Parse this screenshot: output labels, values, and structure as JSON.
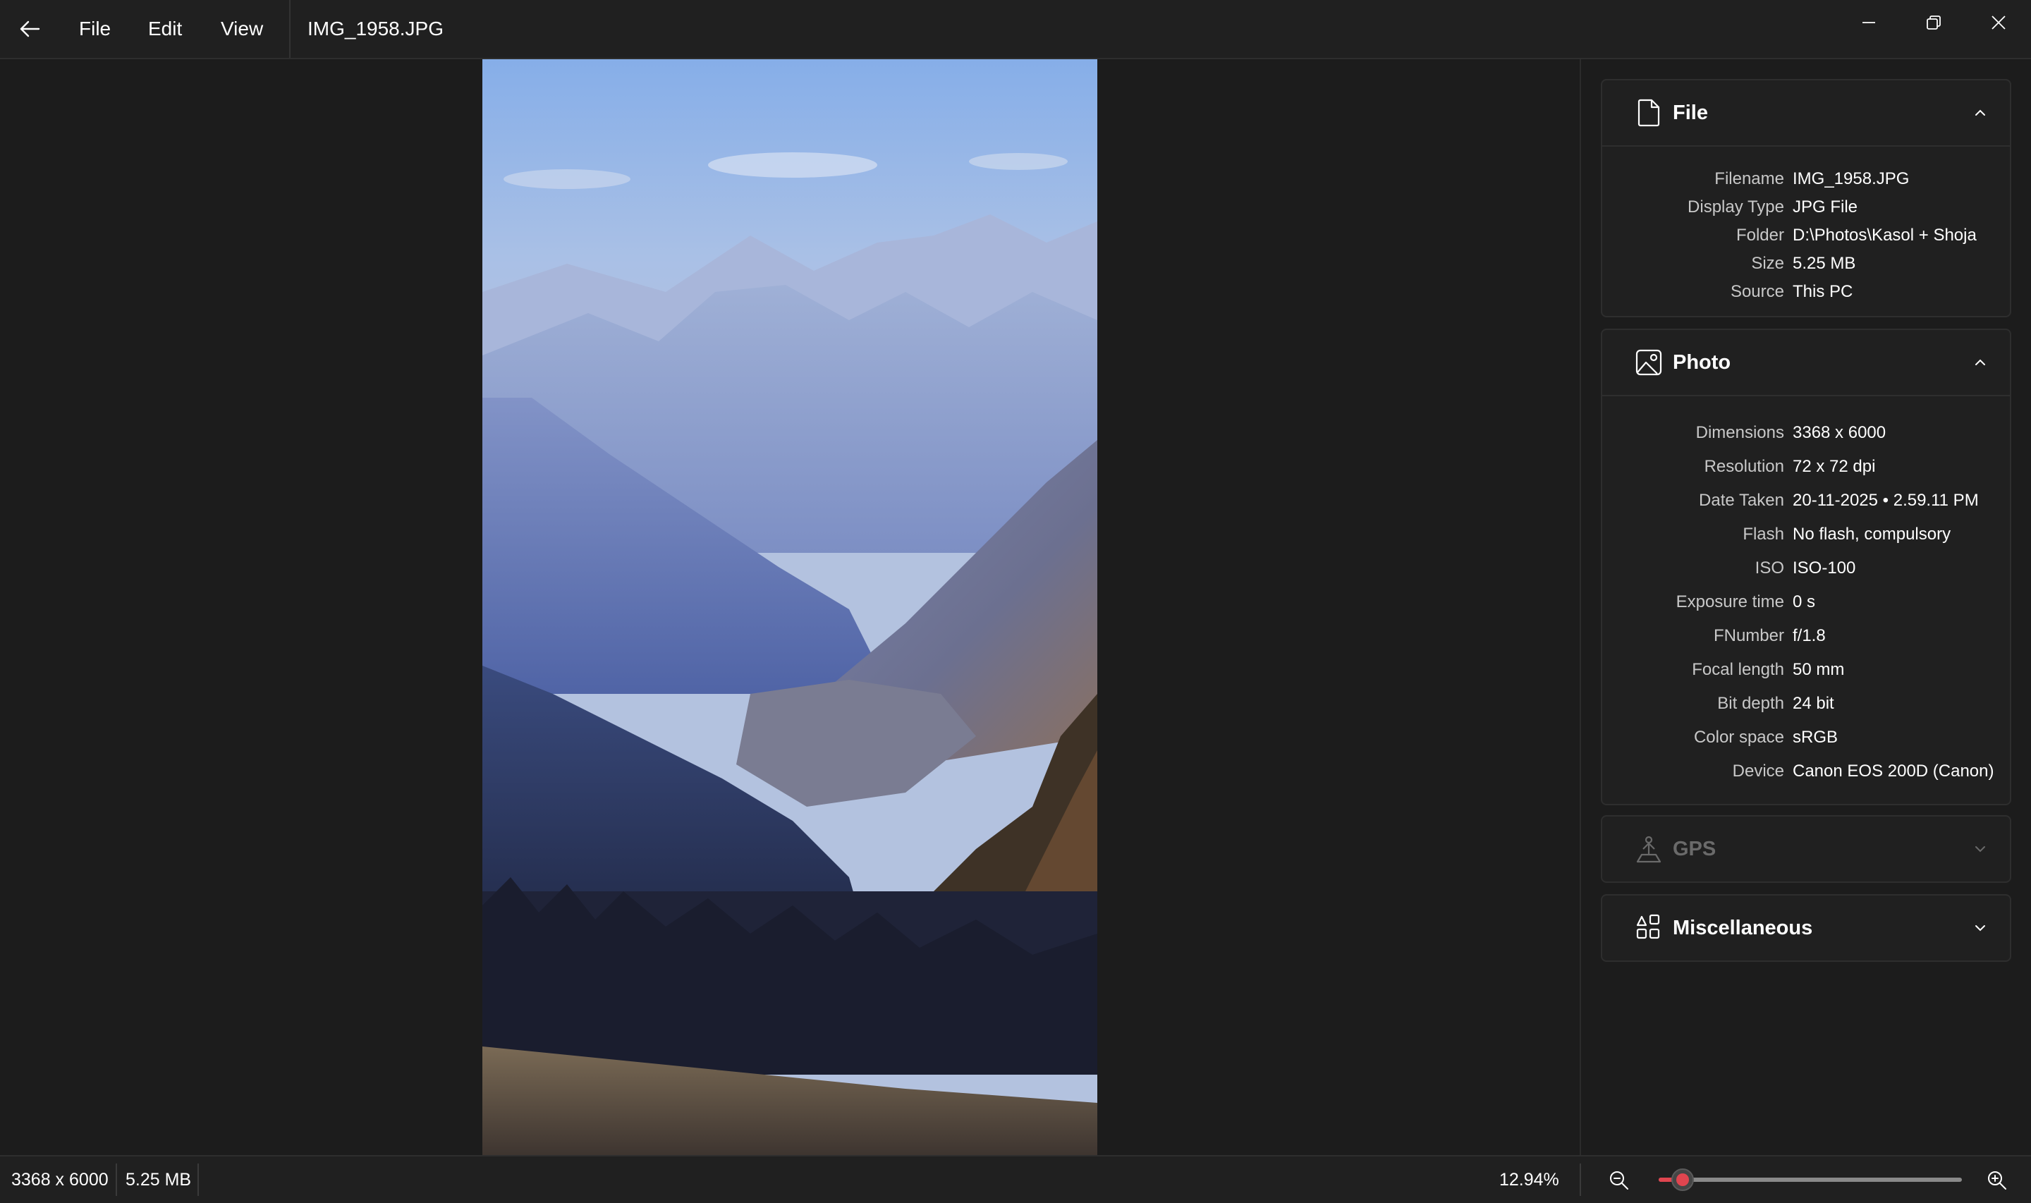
{
  "titlebar": {
    "menu": {
      "file": "File",
      "edit": "Edit",
      "view": "View"
    },
    "filename": "IMG_1958.JPG"
  },
  "panel": {
    "file": {
      "title": "File",
      "icon": "document-icon",
      "rows": [
        {
          "label": "Filename",
          "value": "IMG_1958.JPG"
        },
        {
          "label": "Display Type",
          "value": "JPG File"
        },
        {
          "label": "Folder",
          "value": "D:\\Photos\\Kasol + Shoja"
        },
        {
          "label": "Size",
          "value": "5.25 MB"
        },
        {
          "label": "Source",
          "value": "This PC"
        }
      ]
    },
    "photo": {
      "title": "Photo",
      "icon": "image-icon",
      "rows": [
        {
          "label": "Dimensions",
          "value": "3368 x 6000"
        },
        {
          "label": "Resolution",
          "value": "72 x 72 dpi"
        },
        {
          "label": "Date Taken",
          "value": "20-11-2025 • 2.59.11 PM"
        },
        {
          "label": "Flash",
          "value": "No flash, compulsory"
        },
        {
          "label": "ISO",
          "value": "ISO-100"
        },
        {
          "label": "Exposure time",
          "value": "0 s"
        },
        {
          "label": "FNumber",
          "value": "f/1.8"
        },
        {
          "label": "Focal length",
          "value": "50 mm"
        },
        {
          "label": "Bit depth",
          "value": "24 bit"
        },
        {
          "label": "Color space",
          "value": "sRGB"
        },
        {
          "label": "Device",
          "value": "Canon EOS 200D (Canon)"
        }
      ]
    },
    "gps": {
      "title": "GPS",
      "icon": "location-person-icon",
      "enabled": false
    },
    "misc": {
      "title": "Miscellaneous",
      "icon": "shapes-icon"
    }
  },
  "statusbar": {
    "dimensions": "3368 x 6000",
    "size": "5.25 MB",
    "zoom": "12.94%",
    "zoom_slider_fraction": 0.06
  },
  "colors": {
    "accent": "#e0454f",
    "background": "#1c1c1c",
    "panel": "#202020"
  }
}
